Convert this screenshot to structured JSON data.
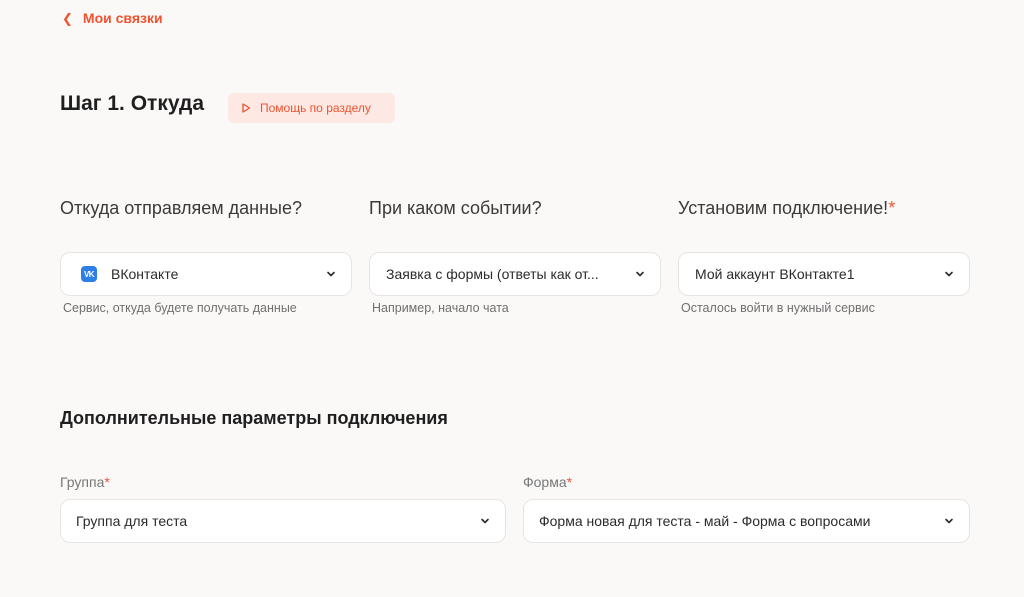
{
  "nav": {
    "back_label": "Мои связки"
  },
  "step": {
    "title": "Шаг 1. Откуда",
    "help_label": "Помощь по разделу"
  },
  "source": {
    "question": "Откуда отправляем данные?",
    "value": "ВКонтакте",
    "icon": "vk-logo-icon",
    "icon_text": "VK",
    "hint": "Сервис, откуда будете получать данные"
  },
  "event": {
    "question": "При каком событии?",
    "value": "Заявка с формы (ответы как от...",
    "hint": "Например, начало чата"
  },
  "connection": {
    "question": "Установим подключение!",
    "required_mark": "*",
    "value": "Мой аккаунт ВКонтакте1",
    "hint": "Осталось войти в нужный сервис"
  },
  "extra": {
    "title": "Дополнительные параметры подключения",
    "group": {
      "label": "Группа",
      "required_mark": "*",
      "value": "Группа для теста"
    },
    "form": {
      "label": "Форма",
      "required_mark": "*",
      "value": "Форма новая для теста - май - Форма с вопросами"
    }
  },
  "colors": {
    "accent": "#f0532f",
    "accent_bg": "#fde8e3",
    "background": "#fbf9f8",
    "vk_blue": "#2d7fe8"
  }
}
